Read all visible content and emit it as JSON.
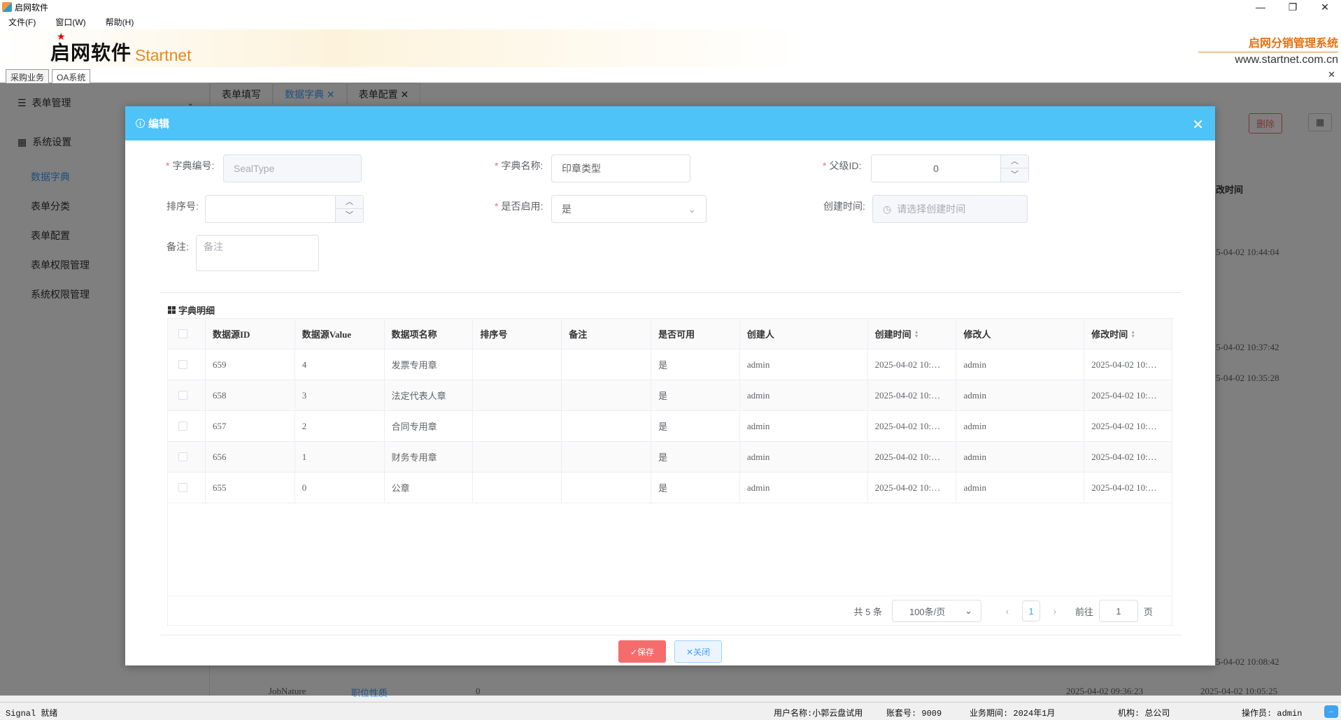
{
  "window": {
    "title": "启网软件",
    "minimize": "—",
    "restore": "❐",
    "close": "✕"
  },
  "menu": [
    "文件(F)",
    "窗口(W)",
    "帮助(H)"
  ],
  "banner": {
    "logo_cn": "启网软件",
    "logo_en": "Startnet",
    "product": "启网分销管理系统",
    "website": "www.startnet.com.cn"
  },
  "module_tabs": [
    "采购业务",
    "OA系统"
  ],
  "sidebar": {
    "groups": [
      "表单管理",
      "系统设置"
    ],
    "items": [
      "数据字典",
      "表单分类",
      "表单配置",
      "表单权限管理",
      "系统权限管理"
    ]
  },
  "page_tabs": [
    "表单填写",
    "数据字典",
    "表单配置"
  ],
  "background": {
    "btn_delete": "删除",
    "col_mod_time": "改时间",
    "times": [
      "5-04-02 10:44:04",
      "5-04-02 10:37:42",
      "5-04-02 10:35:28",
      "5-04-02 10:08:42"
    ],
    "bottom_row": [
      "JobNature",
      "职位性质",
      "0",
      "2025-04-02 09:36:23",
      "2025-04-02 10:05:25"
    ]
  },
  "dialog": {
    "title": "编辑",
    "form": {
      "dict_code_label": "字典编号:",
      "dict_code_value": "SealType",
      "dict_name_label": "字典名称:",
      "dict_name_value": "印章类型",
      "parent_id_label": "父级ID:",
      "parent_id_value": "0",
      "sort_label": "排序号:",
      "sort_value": "",
      "enabled_label": "是否启用:",
      "enabled_value": "是",
      "created_label": "创建时间:",
      "created_placeholder": "请选择创建时间",
      "remark_label": "备注:",
      "remark_placeholder": "备注"
    },
    "section_title": "字典明细",
    "table": {
      "columns": [
        "数据源ID",
        "数据源Value",
        "数据项名称",
        "排序号",
        "备注",
        "是否可用",
        "创建人",
        "创建时间",
        "修改人",
        "修改时间"
      ],
      "rows": [
        [
          "659",
          "4",
          "发票专用章",
          "",
          "",
          "是",
          "admin",
          "2025-04-02 10:…",
          "admin",
          "2025-04-02 10:…"
        ],
        [
          "658",
          "3",
          "法定代表人章",
          "",
          "",
          "是",
          "admin",
          "2025-04-02 10:…",
          "admin",
          "2025-04-02 10:…"
        ],
        [
          "657",
          "2",
          "合同专用章",
          "",
          "",
          "是",
          "admin",
          "2025-04-02 10:…",
          "admin",
          "2025-04-02 10:…"
        ],
        [
          "656",
          "1",
          "财务专用章",
          "",
          "",
          "是",
          "admin",
          "2025-04-02 10:…",
          "admin",
          "2025-04-02 10:…"
        ],
        [
          "655",
          "0",
          "公章",
          "",
          "",
          "是",
          "admin",
          "2025-04-02 10:…",
          "admin",
          "2025-04-02 10:…"
        ]
      ]
    },
    "pager": {
      "total": "共 5 条",
      "page_size": "100条/页",
      "current": "1",
      "goto_label": "前往",
      "goto_value": "1",
      "page_suffix": "页"
    },
    "save_label": "✓保存",
    "close_label": "✕关闭"
  },
  "status": {
    "left": "Signal 就绪",
    "user": "用户名称:小郭云盘试用",
    "account": "账套号: 9009",
    "period": "业务期间: 2024年1月",
    "org": "机构: 总公司",
    "operator": "操作员: admin"
  },
  "colors": {
    "dialog_header": "#4ec3f7",
    "save": "#f56c6c",
    "accent": "#409eff"
  }
}
